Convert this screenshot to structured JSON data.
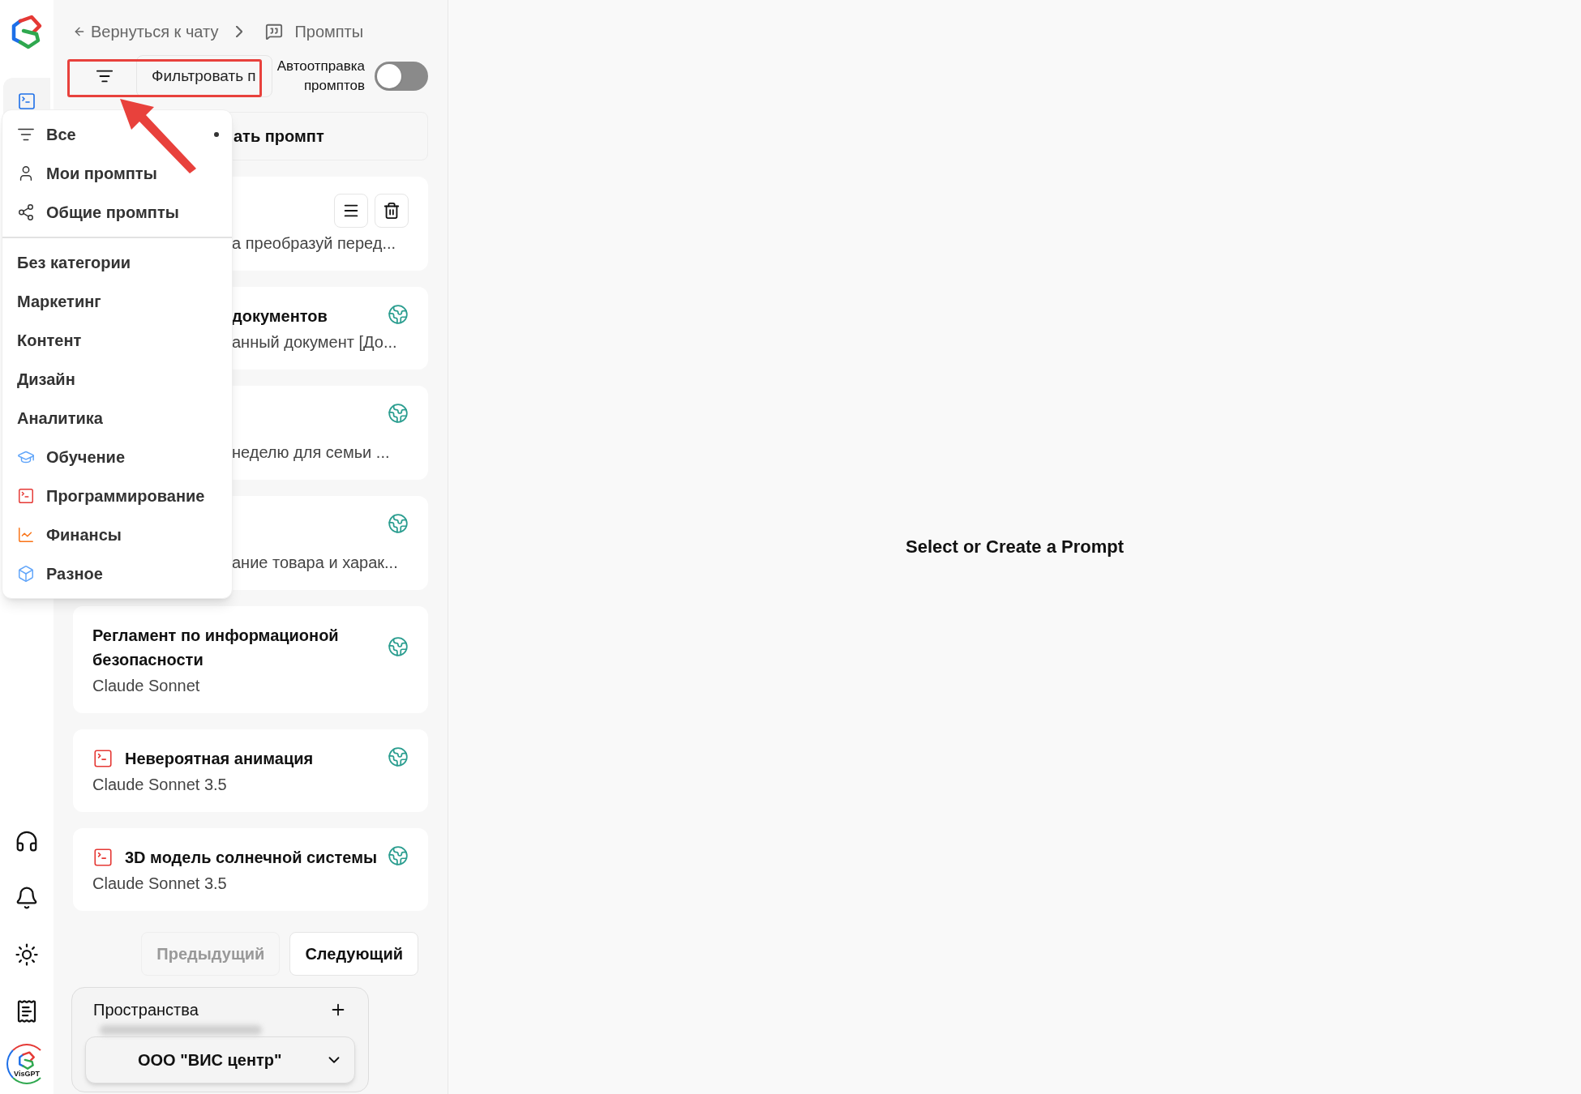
{
  "breadcrumb": {
    "back": "Вернуться к чату",
    "current": "Промпты"
  },
  "nav": [
    {
      "kind": "prompts",
      "selected": true
    },
    {
      "kind": "support",
      "selected": false
    },
    {
      "kind": "notifications",
      "selected": false
    },
    {
      "kind": "theme",
      "selected": false
    },
    {
      "kind": "docs",
      "selected": false
    }
  ],
  "avatar_label": "VisGPT",
  "filter": {
    "placeholder": "Фильтровать п"
  },
  "autosend": {
    "label": "Автоотправка промптов",
    "on": false
  },
  "create_button": "ать промпт",
  "dropdown": {
    "filters": [
      {
        "kind": "all",
        "label": "Все",
        "selected": true
      },
      {
        "kind": "mine",
        "label": "Мои промпты",
        "selected": false
      },
      {
        "kind": "shared",
        "label": "Общие промпты",
        "selected": false
      }
    ],
    "categories": [
      {
        "kind": "plain",
        "label": "Без категории"
      },
      {
        "kind": "plain",
        "label": "Маркетинг"
      },
      {
        "kind": "plain",
        "label": "Контент"
      },
      {
        "kind": "plain",
        "label": "Дизайн"
      },
      {
        "kind": "plain",
        "label": "Аналитика"
      },
      {
        "kind": "education",
        "label": "Обучение"
      },
      {
        "kind": "code",
        "label": "Программирование"
      },
      {
        "kind": "finance",
        "label": "Финансы"
      },
      {
        "kind": "misc",
        "label": "Разное"
      }
    ]
  },
  "cards": [
    {
      "subtitle": "а преобразуй перед...",
      "covered": true,
      "code_icon": false,
      "shared": false,
      "actions": true
    },
    {
      "title": "документов",
      "subtitle": "анный документ [До...",
      "covered": true,
      "code_icon": false,
      "shared": true,
      "actions": false
    },
    {
      "subtitle": "неделю для семьи ...",
      "covered": true,
      "code_icon": false,
      "shared": true,
      "actions": false
    },
    {
      "subtitle": "ание товара и харак...",
      "covered": true,
      "code_icon": false,
      "shared": true,
      "actions": false
    },
    {
      "title": "Регламент по информационой безопасности",
      "subtitle": "Claude Sonnet",
      "covered": false,
      "code_icon": false,
      "shared": true,
      "actions": false
    },
    {
      "title": "Невероятная анимация",
      "subtitle": "Claude Sonnet 3.5",
      "covered": false,
      "code_icon": true,
      "shared": true,
      "actions": false
    },
    {
      "title": "3D модель солнечной системы",
      "subtitle": "Claude Sonnet 3.5",
      "covered": false,
      "code_icon": true,
      "shared": true,
      "actions": false
    }
  ],
  "pagination": [
    {
      "label": "Предыдущий",
      "disabled": true
    },
    {
      "label": "Следующий",
      "disabled": false
    }
  ],
  "spaces": {
    "title": "Пространства",
    "selected": "ООО \"ВИС центр\""
  },
  "main": {
    "message": "Select or Create a Prompt"
  }
}
